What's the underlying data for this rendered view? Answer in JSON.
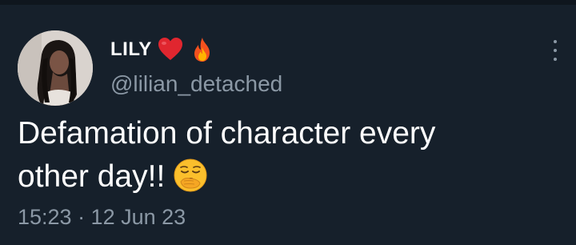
{
  "tweet": {
    "author": {
      "display_name": "LILY",
      "name_emojis": [
        "red-heart-emoji",
        "fire-emoji"
      ],
      "handle": "@lilian_detached",
      "avatar": "profile-photo"
    },
    "text_lines": [
      "Defamation of character every",
      "other day!!"
    ],
    "text_emoji": "yawning-face-emoji",
    "timestamp": "15:23 · 12 Jun 23",
    "menu_icon": "more-vertical-icon"
  },
  "colors": {
    "background": "#16202b",
    "text": "#ffffff",
    "secondary_text": "#8b98a5"
  }
}
